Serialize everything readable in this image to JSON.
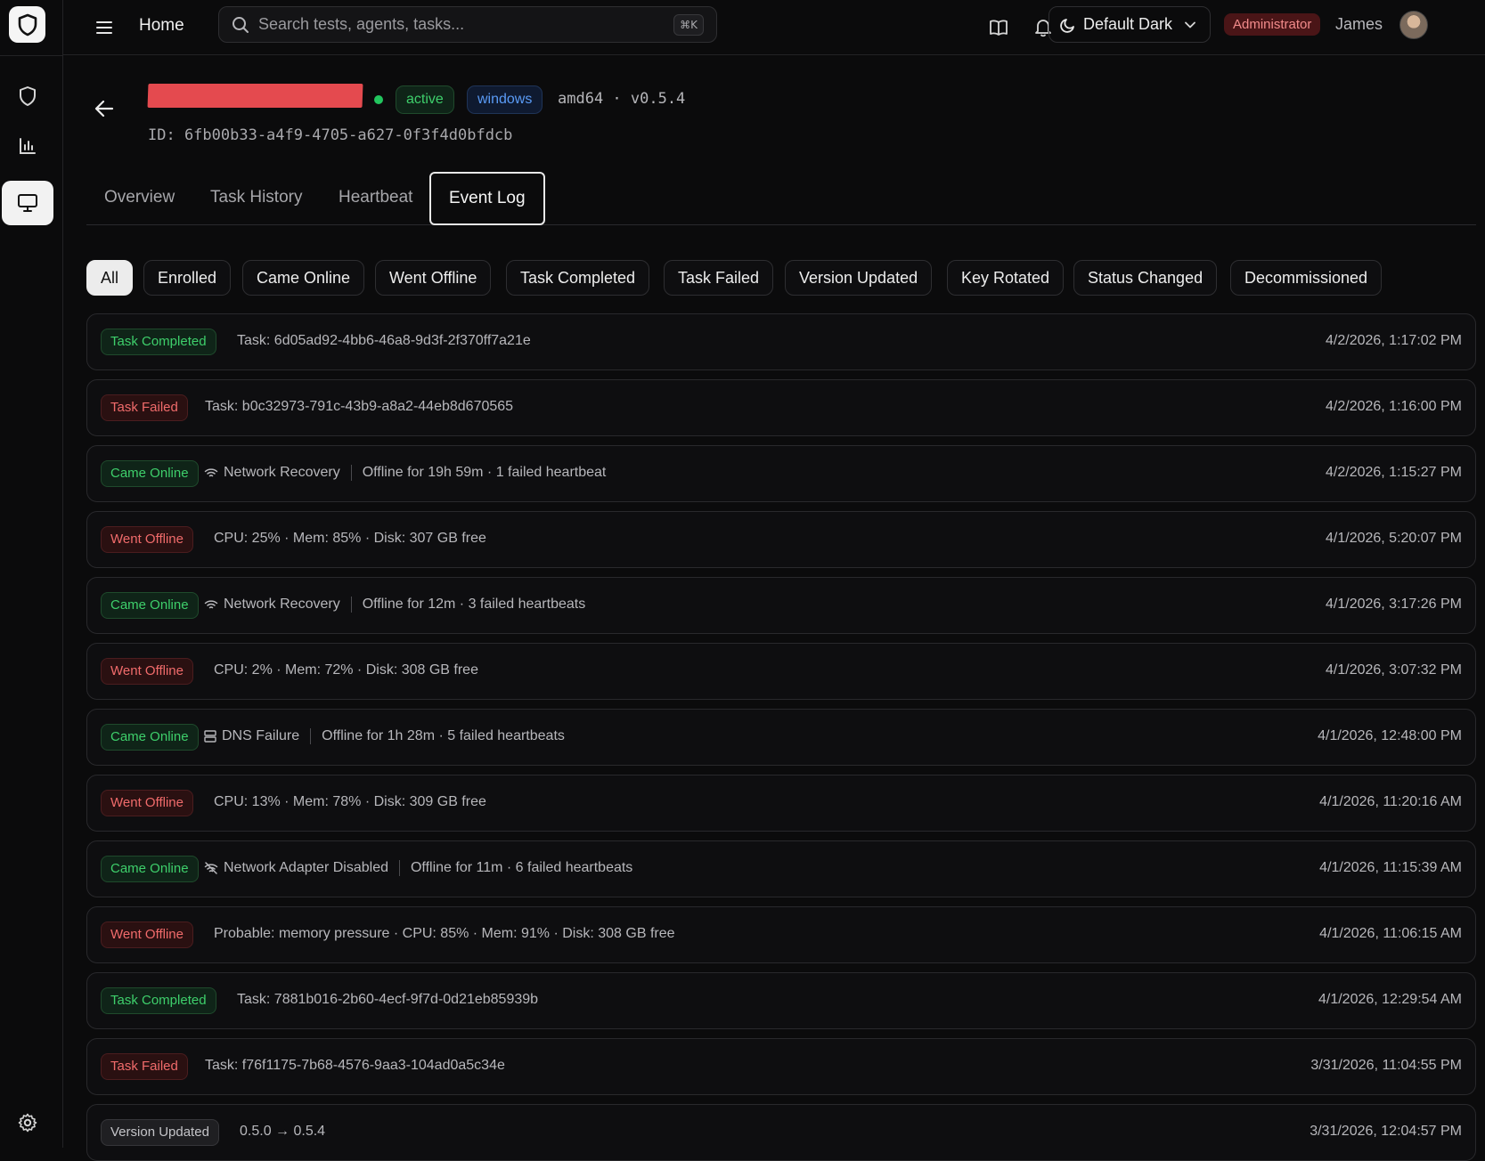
{
  "topbar": {
    "title": "Home",
    "search_placeholder": "Search tests, agents, tasks...",
    "search_shortcut": "⌘K",
    "theme": "Default Dark",
    "role": "Administrator",
    "user": "James"
  },
  "agent": {
    "name": "[redacted]",
    "status": "active",
    "os": "windows",
    "arch_version": "amd64 · v0.5.4",
    "id": "ID: 6fb00b33-a4f9-4705-a627-0f3f4d0bfdcb"
  },
  "tabs": [
    "Overview",
    "Task History",
    "Heartbeat",
    "Event Log"
  ],
  "active_tab": "Event Log",
  "filters": [
    "All",
    "Enrolled",
    "Came Online",
    "Went Offline",
    "Task Completed",
    "Task Failed",
    "Version Updated",
    "Key Rotated",
    "Status Changed",
    "Decommissioned"
  ],
  "active_filter": "All",
  "events": [
    {
      "type": "Task Completed",
      "color": "green",
      "icon": "",
      "reason": "",
      "detail": "Task: 6d05ad92-4bb6-46a8-9d3f-2f370ff7a21e",
      "time": "4/2/2026, 1:17:02 PM"
    },
    {
      "type": "Task Failed",
      "color": "red",
      "icon": "",
      "reason": "",
      "detail": "Task: b0c32973-791c-43b9-a8a2-44eb8d670565",
      "time": "4/2/2026, 1:16:00 PM"
    },
    {
      "type": "Came Online",
      "color": "green",
      "icon": "wifi-icon",
      "reason": "Network Recovery",
      "detail": "Offline for 19h 59m · 1 failed heartbeat",
      "time": "4/2/2026, 1:15:27 PM"
    },
    {
      "type": "Went Offline",
      "color": "red",
      "icon": "",
      "reason": "",
      "detail": "CPU: 25% · Mem: 85% · Disk: 307 GB free",
      "time": "4/1/2026, 5:20:07 PM"
    },
    {
      "type": "Came Online",
      "color": "green",
      "icon": "wifi-icon",
      "reason": "Network Recovery",
      "detail": "Offline for 12m · 3 failed heartbeats",
      "time": "4/1/2026, 3:17:26 PM"
    },
    {
      "type": "Went Offline",
      "color": "red",
      "icon": "",
      "reason": "",
      "detail": "CPU: 2% · Mem: 72% · Disk: 308 GB free",
      "time": "4/1/2026, 3:07:32 PM"
    },
    {
      "type": "Came Online",
      "color": "green",
      "icon": "server-icon",
      "reason": "DNS Failure",
      "detail": "Offline for 1h 28m · 5 failed heartbeats",
      "time": "4/1/2026, 12:48:00 PM"
    },
    {
      "type": "Went Offline",
      "color": "red",
      "icon": "",
      "reason": "",
      "detail": "CPU: 13% · Mem: 78% · Disk: 309 GB free",
      "time": "4/1/2026, 11:20:16 AM"
    },
    {
      "type": "Came Online",
      "color": "green",
      "icon": "wifi-off-icon",
      "reason": "Network Adapter Disabled",
      "detail": "Offline for 11m · 6 failed heartbeats",
      "time": "4/1/2026, 11:15:39 AM"
    },
    {
      "type": "Went Offline",
      "color": "red",
      "icon": "",
      "reason": "",
      "detail": "Probable: memory pressure · CPU: 85% · Mem: 91% · Disk: 308 GB free",
      "time": "4/1/2026, 11:06:15 AM"
    },
    {
      "type": "Task Completed",
      "color": "green",
      "icon": "",
      "reason": "",
      "detail": "Task: 7881b016-2b60-4ecf-9f7d-0d21eb85939b",
      "time": "4/1/2026, 12:29:54 AM"
    },
    {
      "type": "Task Failed",
      "color": "red",
      "icon": "",
      "reason": "",
      "detail": "Task: f76f1175-7b68-4576-9aa3-104ad0a5c34e",
      "time": "3/31/2026, 11:04:55 PM"
    },
    {
      "type": "Version Updated",
      "color": "gray",
      "icon": "",
      "reason": "",
      "detail": "0.5.0 → 0.5.4",
      "time": "3/31/2026, 12:04:57 PM"
    }
  ]
}
